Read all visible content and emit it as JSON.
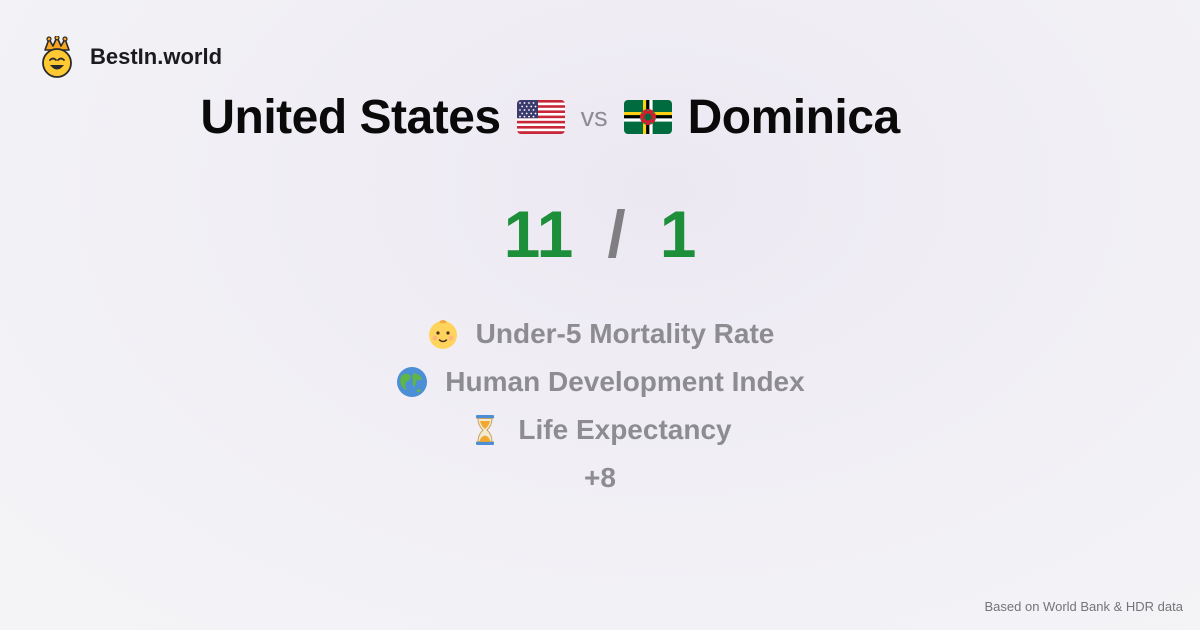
{
  "brand": {
    "name": "BestIn.world",
    "logo_icon": "crown-smiley-icon"
  },
  "comparison": {
    "country_a": "United States",
    "flag_a": "us-flag-icon",
    "vs_label": "vs",
    "country_b": "Dominica",
    "flag_b": "dominica-flag-icon"
  },
  "score": {
    "a": "11",
    "separator": "/",
    "b": "1"
  },
  "metrics": [
    {
      "icon": "baby-icon",
      "label": "Under-5 Mortality Rate"
    },
    {
      "icon": "globe-icon",
      "label": "Human Development Index"
    },
    {
      "icon": "hourglass-icon",
      "label": "Life Expectancy"
    }
  ],
  "more_label": "+8",
  "footer_text": "Based on World Bank & HDR data",
  "colors": {
    "score_green": "#1d8f3b",
    "muted_text": "#8d8d91"
  }
}
